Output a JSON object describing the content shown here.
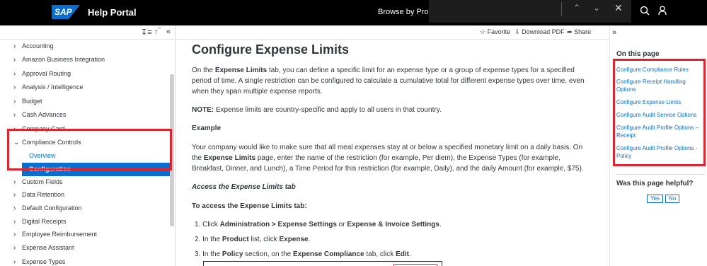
{
  "header": {
    "logo_text": "SAP",
    "title": "Help Portal",
    "browse_label": "Browse by Product"
  },
  "findbar": {
    "prev_icon": "chevron-up-icon",
    "next_icon": "chevron-down-icon",
    "close_icon": "close-icon"
  },
  "sidebar": {
    "items": [
      {
        "label": "Accounting"
      },
      {
        "label": "Amazon Business Integration"
      },
      {
        "label": "Approval Routing"
      },
      {
        "label": "Analysis / Intelligence"
      },
      {
        "label": "Budget"
      },
      {
        "label": "Cash Advances"
      },
      {
        "label": "Company Card"
      },
      {
        "label": "Compliance Controls"
      },
      {
        "label": "Custom Fields"
      },
      {
        "label": "Data Retention"
      },
      {
        "label": "Default Configuration"
      },
      {
        "label": "Digital Receipts"
      },
      {
        "label": "Employee Reimbursement"
      },
      {
        "label": "Expense Assistant"
      },
      {
        "label": "Expense Types"
      }
    ],
    "sub_items": [
      {
        "label": "Overview"
      },
      {
        "label": "Configuration"
      }
    ]
  },
  "toolbar": {
    "favorite": "Favorite",
    "download": "Download PDF",
    "share": "Share"
  },
  "main": {
    "title": "Configure Expense Limits",
    "p1_a": "On the ",
    "p1_b": "Expense Limits",
    "p1_c": " tab, you can define a specific limit for an expense type or a group of expense types for a specified period of time. A single restriction can be configured to calculate a cumulative total for different expense types over time, even when they span multiple expense reports.",
    "note_label": "NOTE:",
    "note_text": " Expense limits are country-specific and apply to all users in that country.",
    "example_heading": "Example",
    "ex_a": "Your company would like to make sure that all meal expenses stay at or below a specified monetary limit on a daily basis. On the ",
    "ex_b": "Expense Limits",
    "ex_c": " page, enter the name of the restriction (for example, Per diem), the Expense Types (for example, Breakfast, Dinner, and Lunch), a Time Period for this restriction (for example, Daily), and the daily Amount (for example, $75).",
    "access_heading": "Access the Expense Limits tab",
    "to_access": "To access the Expense Limits tab:",
    "step1_a": "1. Click ",
    "step1_b": "Administration > Expense Settings",
    "step1_c": " or ",
    "step1_d": "Expense & Invoice Settings",
    "step1_e": ".",
    "step2_a": "2. In the ",
    "step2_b": "Product",
    "step2_c": " list, click ",
    "step2_d": "Expense",
    "step2_e": ".",
    "step3_a": "3. In the ",
    "step3_b": "Policy",
    "step3_c": " section, on the ",
    "step3_d": "Expense Compliance",
    "step3_e": " tab, click ",
    "step3_f": "Edit",
    "step3_g": "."
  },
  "right": {
    "on_this_page": "On this page",
    "links": [
      "Configure Compliance Rules",
      "Configure Receipt Handling Options",
      "Configure Expense Limits",
      "Configure Audit Service Options",
      "Configure Audit Profile Options – Receipt",
      "Configure Audit Profile Options - Policy"
    ],
    "helpful": "Was this page helpful?",
    "yes": "Yes",
    "no": "No"
  },
  "colors": {
    "accent": "#0a6ed1",
    "highlight": "#e0242f",
    "topbar": "#000000"
  }
}
